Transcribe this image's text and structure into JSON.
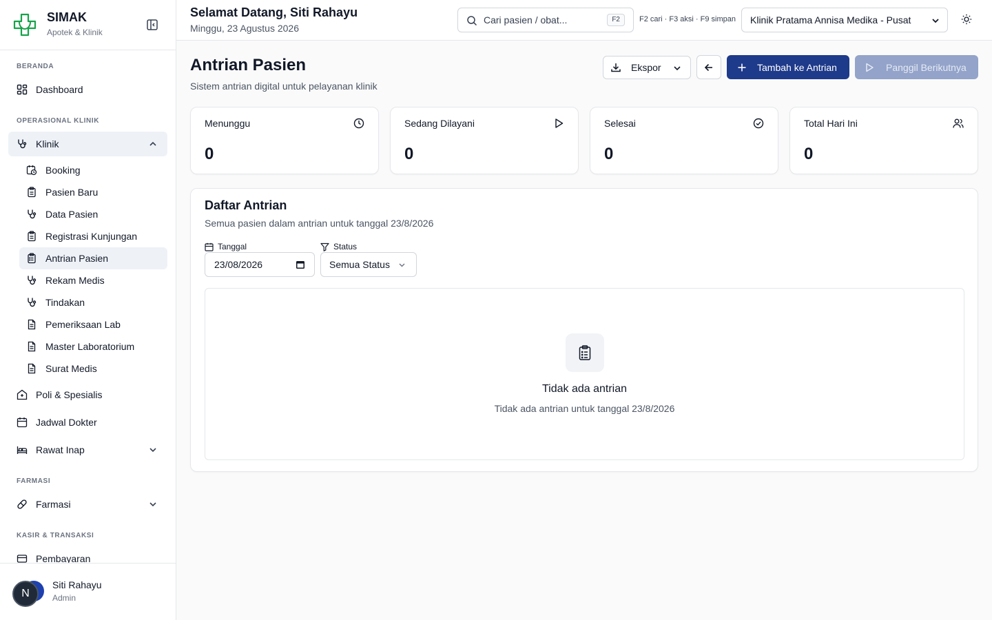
{
  "brand": {
    "name": "SIMAK",
    "subtitle": "Apotek & Klinik",
    "color": "#16a34a"
  },
  "sidebar": {
    "sections": [
      "BERANDA",
      "OPERASIONAL KLINIK",
      "FARMASI",
      "KASIR & TRANSAKSI"
    ],
    "dashboard": "Dashboard",
    "klinik": "Klinik",
    "klinik_items": [
      "Booking",
      "Pasien Baru",
      "Data Pasien",
      "Registrasi Kunjungan",
      "Antrian Pasien",
      "Rekam Medis",
      "Tindakan",
      "Pemeriksaan Lab",
      "Master Laboratorium",
      "Surat Medis"
    ],
    "poli": "Poli & Spesialis",
    "jadwal": "Jadwal Dokter",
    "rawat_inap": "Rawat Inap",
    "farmasi": "Farmasi",
    "pembayaran": "Pembayaran"
  },
  "user": {
    "initial": "N",
    "name": "Siti Rahayu",
    "role": "Admin"
  },
  "topbar": {
    "greeting": "Selamat Datang, Siti Rahayu",
    "date": "Minggu, 23 Agustus 2026",
    "search_placeholder": "Cari pasien / obat...",
    "search_key": "F2",
    "hints": "F2 cari · F3 aksi · F9 simpan",
    "clinic": "Klinik Pratama Annisa Medika - Pusat"
  },
  "page": {
    "title": "Antrian Pasien",
    "subtitle": "Sistem antrian digital untuk pelayanan klinik",
    "export_label": "Ekspor",
    "add_label": "Tambah ke Antrian",
    "next_label": "Panggil Berikutnya",
    "accent": "#1e3a8a"
  },
  "stats": [
    {
      "label": "Menunggu",
      "value": "0",
      "icon": "clock-icon"
    },
    {
      "label": "Sedang Dilayani",
      "value": "0",
      "icon": "play-icon"
    },
    {
      "label": "Selesai",
      "value": "0",
      "icon": "check-circle-icon"
    },
    {
      "label": "Total Hari Ini",
      "value": "0",
      "icon": "users-icon"
    }
  ],
  "queue": {
    "title": "Daftar Antrian",
    "subtitle": "Semua pasien dalam antrian untuk tanggal 23/8/2026",
    "date_label": "Tanggal",
    "date_value": "23/08/2026",
    "status_label": "Status",
    "status_value": "Semua Status",
    "empty_title": "Tidak ada antrian",
    "empty_sub": "Tidak ada antrian untuk tanggal 23/8/2026"
  }
}
